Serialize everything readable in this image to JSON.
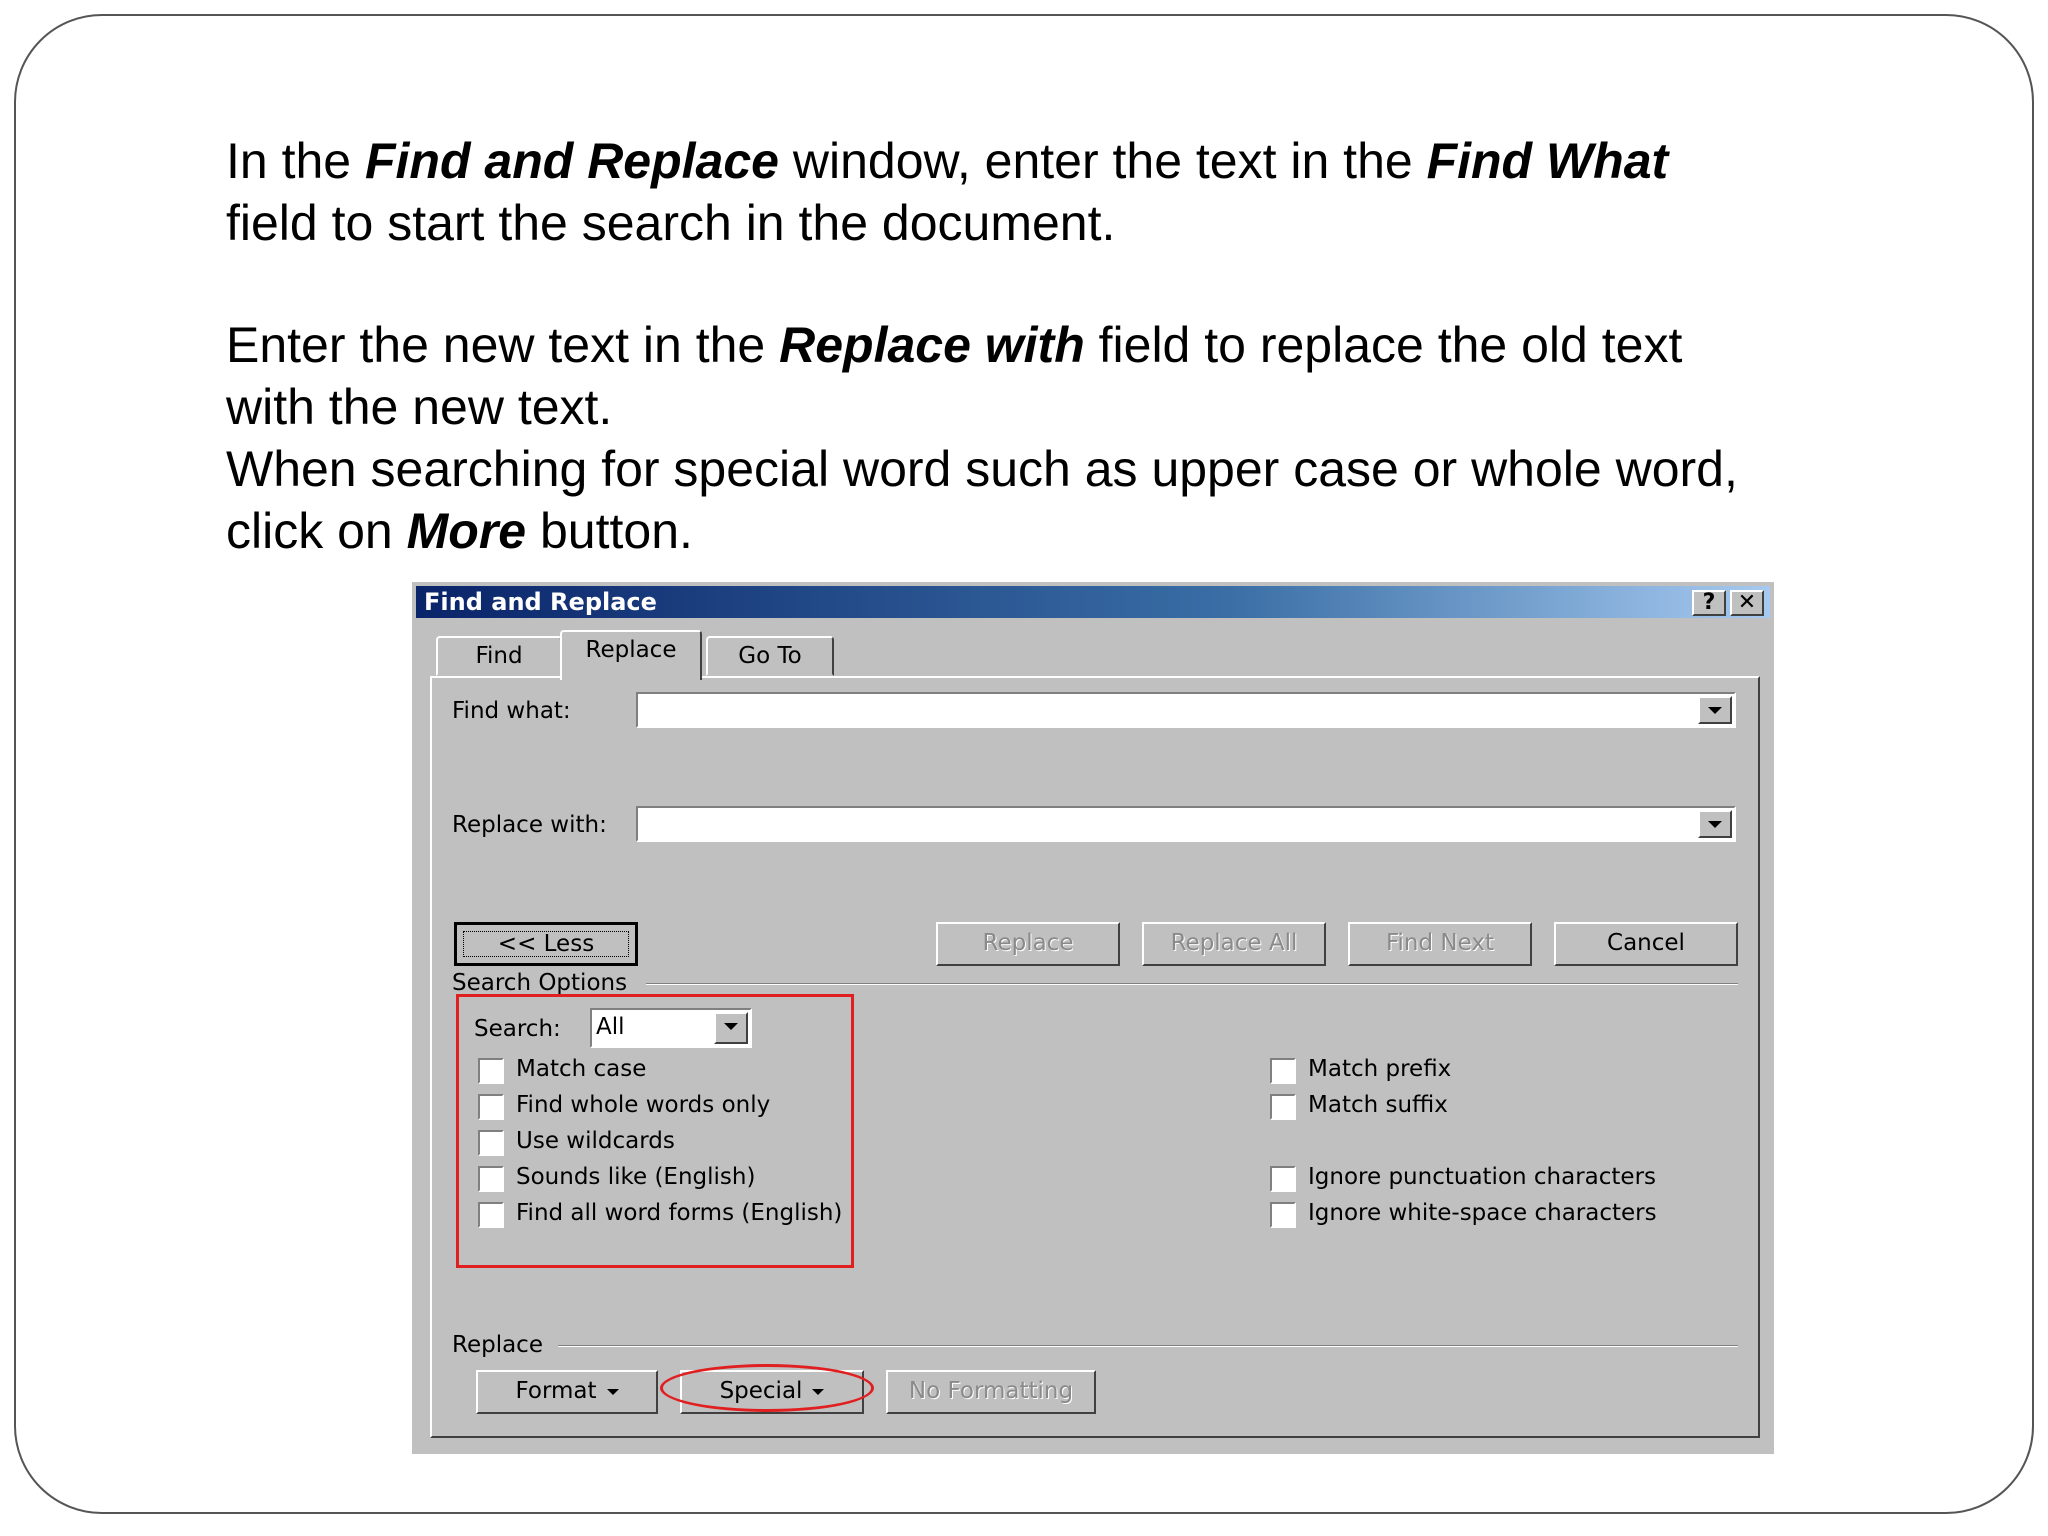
{
  "slide": {
    "p1_a": "In the ",
    "p1_b": "Find and Replace",
    "p1_c": " window, enter the text in the ",
    "p1_d": "Find What",
    "p1_e": "field to start the search in the document.",
    "p2_a": "Enter the new text in the ",
    "p2_b": "Replace with",
    "p2_c": " field to replace the old text",
    "p2_d": "with the new text.",
    "p3_a": "When searching for special word such as upper case or whole word,",
    "p3_b": "click on ",
    "p3_c": "More",
    "p3_d": " button."
  },
  "dialog": {
    "title": "Find and Replace",
    "help_label": "?",
    "close_label": "✕",
    "tabs": [
      "Find",
      "Replace",
      "Go To"
    ],
    "find_what_label": "Find what:",
    "find_what_value": "",
    "replace_with_label": "Replace with:",
    "replace_with_value": "",
    "buttons": {
      "less": "<< Less",
      "replace": "Replace",
      "replace_all": "Replace All",
      "find_next": "Find Next",
      "cancel": "Cancel",
      "format": "Format",
      "special": "Special",
      "no_formatting": "No Formatting"
    },
    "search_options_label": "Search Options",
    "search_label": "Search:",
    "search_value": "All",
    "left_options": [
      "Match case",
      "Find whole words only",
      "Use wildcards",
      "Sounds like (English)",
      "Find all word forms (English)"
    ],
    "right_options": [
      "Match prefix",
      "Match suffix",
      "Ignore punctuation characters",
      "Ignore white-space characters"
    ],
    "replace_group_label": "Replace",
    "highlight_color": "#e02020"
  }
}
